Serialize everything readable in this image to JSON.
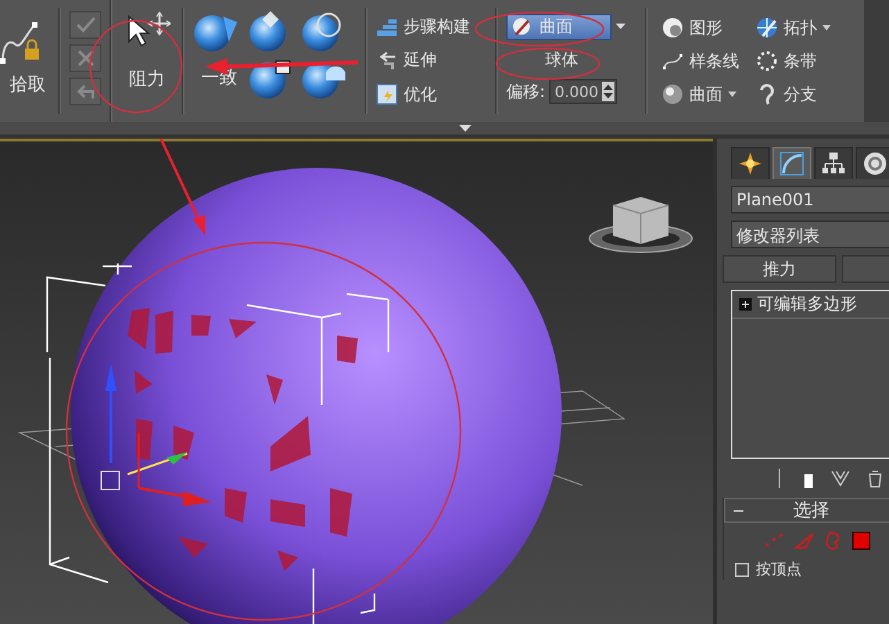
{
  "ribbon": {
    "pick": {
      "label": "拾取"
    },
    "drag": {
      "label": "阻力"
    },
    "conform": {
      "label": "一致"
    },
    "tools": [
      {
        "kind": "step",
        "label": "步骤构建"
      },
      {
        "kind": "extend",
        "label": "延伸"
      },
      {
        "kind": "optimize",
        "label": "优化"
      }
    ],
    "surface_dropdown": {
      "value": "曲面"
    },
    "sphere_button": {
      "label": "球体"
    },
    "offset": {
      "label": "偏移:",
      "value": "0.000"
    },
    "shape_tools": [
      {
        "kind": "shape",
        "label": "图形",
        "has_dropdown": false
      },
      {
        "kind": "spline",
        "label": "样条线",
        "has_dropdown": false
      },
      {
        "kind": "surface",
        "label": "曲面",
        "has_dropdown": true
      },
      {
        "kind": "topology",
        "label": "拓扑",
        "has_dropdown": true
      },
      {
        "kind": "strip",
        "label": "条带",
        "has_dropdown": false
      },
      {
        "kind": "branch",
        "label": "分支",
        "has_dropdown": false
      }
    ]
  },
  "command_panel": {
    "tabs": [
      {
        "kind": "create",
        "selected": false
      },
      {
        "kind": "modify",
        "selected": true
      },
      {
        "kind": "hierarchy",
        "selected": false
      },
      {
        "kind": "motion",
        "selected": false
      }
    ],
    "object_name": "Plane001",
    "modifier_list": "修改器列表",
    "buttons": [
      "推力"
    ],
    "stack": [
      {
        "label": "可编辑多边形",
        "expanded": false
      }
    ],
    "rollout": {
      "title": "选择",
      "expanded": true
    },
    "checkbox": {
      "label": "按顶点",
      "checked": false
    }
  }
}
